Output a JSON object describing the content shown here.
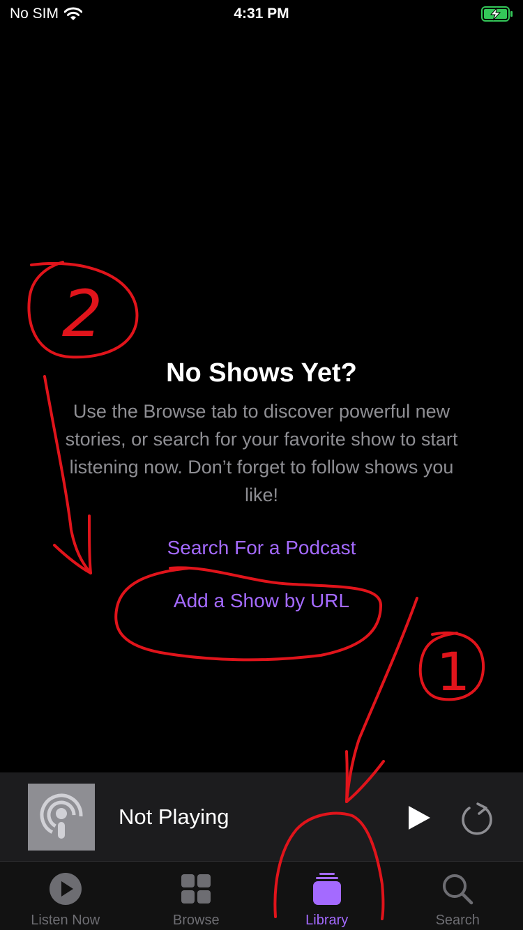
{
  "status_bar": {
    "carrier": "No SIM",
    "time": "4:31 PM"
  },
  "empty_state": {
    "title": "No Shows Yet?",
    "body": "Use the Browse tab to discover powerful new stories, or search for your favorite show to start listening now. Don’t forget to follow shows you like!",
    "search_link": "Search For a Podcast",
    "url_link": "Add a Show by URL"
  },
  "mini_player": {
    "title": "Not Playing"
  },
  "tab_bar": {
    "tabs": [
      {
        "label": "Listen Now",
        "icon": "play-circle-icon"
      },
      {
        "label": "Browse",
        "icon": "grid-icon"
      },
      {
        "label": "Library",
        "icon": "library-stack-icon",
        "active": true
      },
      {
        "label": "Search",
        "icon": "magnifier-icon"
      }
    ]
  },
  "annotations": {
    "marker_1": "1",
    "marker_2": "2"
  },
  "colors": {
    "accent": "#a46aff",
    "annotation": "#e0141b",
    "battery": "#34c759"
  }
}
